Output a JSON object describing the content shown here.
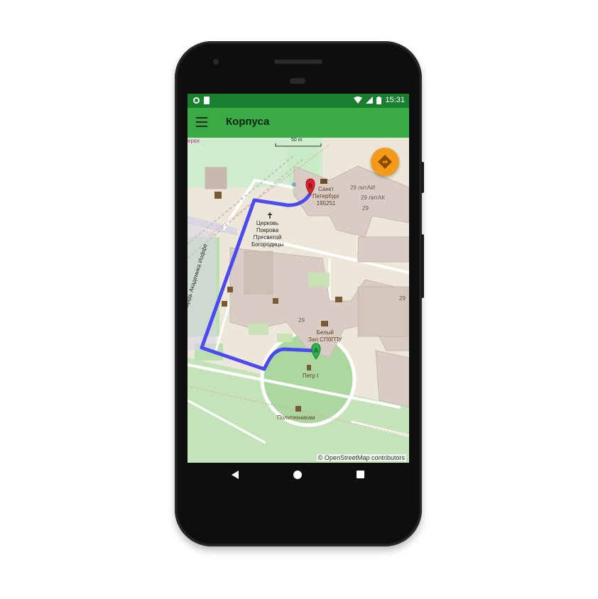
{
  "status_bar": {
    "time": "15:31",
    "icons": [
      "record-icon",
      "sim-icon",
      "wifi-icon",
      "signal-icon",
      "battery-icon"
    ]
  },
  "app_bar": {
    "title": "Корпуса",
    "menu_icon": "hamburger-icon"
  },
  "map": {
    "scale_label": "50 m",
    "attribution": "© OpenStreetMap contributors",
    "top_left_label": "ерки",
    "labels": {
      "post_office": "Санкт\nПетербург\n195251",
      "addr_29_litai": "29 литАИ",
      "addr_29_litak": "29 литАК",
      "num_29_top": "29",
      "church": "Церковь\nПокрова\nПресвятой\nБогородицы",
      "street": "площадь Академика Иоффе",
      "num_29_right": "29",
      "num_29_center": "29",
      "white_hall": "Белый\nЗал СПбГПУ",
      "peter": "Петр I",
      "polytech": "Политехникам"
    },
    "markers": {
      "start": "A",
      "end": "B"
    },
    "route_color": "#4a4af0",
    "fab_icon": "directions-icon"
  },
  "nav_bar": {
    "back_icon": "back-triangle-icon",
    "home_icon": "home-circle-icon",
    "recents_icon": "recents-square-icon"
  },
  "colors": {
    "app_bar": "#3aaa45",
    "status_bar": "#1a7e2f",
    "fab": "#f49a1a",
    "marker_a": "#2db14a",
    "marker_b": "#e0202c"
  }
}
